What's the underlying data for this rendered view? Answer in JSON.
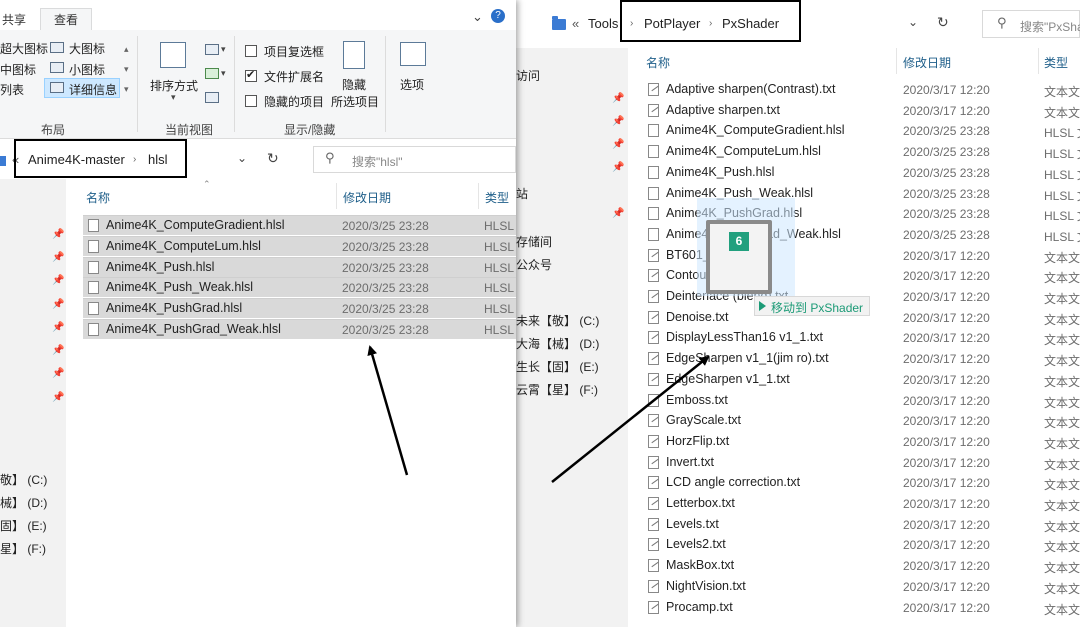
{
  "right_window": {
    "breadcrumb": {
      "overflow": "«",
      "items": [
        "Tools",
        "PotPlayer",
        "PxShader"
      ]
    },
    "search_placeholder": "搜索\"PxShad",
    "nav_items": [
      "访问",
      "站",
      "存储间",
      "公众号",
      "未来【敬】 (C:)",
      "大海【械】 (D:)",
      "生长【固】 (E:)",
      "云霄【星】 (F:)"
    ],
    "columns": {
      "name": "名称",
      "date": "修改日期",
      "type": "类型"
    },
    "files": [
      {
        "name": "Adaptive sharpen(Contrast).txt",
        "date": "2020/3/17 12:20",
        "type": "文本文",
        "kind": "txt"
      },
      {
        "name": "Adaptive sharpen.txt",
        "date": "2020/3/17 12:20",
        "type": "文本文",
        "kind": "txt"
      },
      {
        "name": "Anime4K_ComputeGradient.hlsl",
        "date": "2020/3/25 23:28",
        "type": "HLSL 文",
        "kind": "hlsl"
      },
      {
        "name": "Anime4K_ComputeLum.hlsl",
        "date": "2020/3/25 23:28",
        "type": "HLSL 文",
        "kind": "hlsl"
      },
      {
        "name": "Anime4K_Push.hlsl",
        "date": "2020/3/25 23:28",
        "type": "HLSL 文",
        "kind": "hlsl"
      },
      {
        "name": "Anime4K_Push_Weak.hlsl",
        "date": "2020/3/25 23:28",
        "type": "HLSL 文",
        "kind": "hlsl"
      },
      {
        "name": "Anime4K_PushGrad.hlsl",
        "date": "2020/3/25 23:28",
        "type": "HLSL 文",
        "kind": "hlsl"
      },
      {
        "name": "Anime4K_PushGrad_Weak.hlsl",
        "date": "2020/3/25 23:28",
        "type": "HLSL 文",
        "kind": "hlsl"
      },
      {
        "name": "BT601_BT709.txt",
        "date": "2020/3/17 12:20",
        "type": "文本文",
        "kind": "txt"
      },
      {
        "name": "Contour.txt",
        "date": "2020/3/17 12:20",
        "type": "文本文",
        "kind": "txt"
      },
      {
        "name": "Deinterlace (blend).txt",
        "date": "2020/3/17 12:20",
        "type": "文本文",
        "kind": "txt"
      },
      {
        "name": "Denoise.txt",
        "date": "2020/3/17 12:20",
        "type": "文本文",
        "kind": "txt"
      },
      {
        "name": "DisplayLessThan16 v1_1.txt",
        "date": "2020/3/17 12:20",
        "type": "文本文",
        "kind": "txt"
      },
      {
        "name": "EdgeSharpen v1_1(jim ro).txt",
        "date": "2020/3/17 12:20",
        "type": "文本文",
        "kind": "txt"
      },
      {
        "name": "EdgeSharpen v1_1.txt",
        "date": "2020/3/17 12:20",
        "type": "文本文",
        "kind": "txt"
      },
      {
        "name": "Emboss.txt",
        "date": "2020/3/17 12:20",
        "type": "文本文",
        "kind": "txt"
      },
      {
        "name": "GrayScale.txt",
        "date": "2020/3/17 12:20",
        "type": "文本文",
        "kind": "txt"
      },
      {
        "name": "HorzFlip.txt",
        "date": "2020/3/17 12:20",
        "type": "文本文",
        "kind": "txt"
      },
      {
        "name": "Invert.txt",
        "date": "2020/3/17 12:20",
        "type": "文本文",
        "kind": "txt"
      },
      {
        "name": "LCD angle correction.txt",
        "date": "2020/3/17 12:20",
        "type": "文本文",
        "kind": "txt"
      },
      {
        "name": "Letterbox.txt",
        "date": "2020/3/17 12:20",
        "type": "文本文",
        "kind": "txt"
      },
      {
        "name": "Levels.txt",
        "date": "2020/3/17 12:20",
        "type": "文本文",
        "kind": "txt"
      },
      {
        "name": "Levels2.txt",
        "date": "2020/3/17 12:20",
        "type": "文本文",
        "kind": "txt"
      },
      {
        "name": "MaskBox.txt",
        "date": "2020/3/17 12:20",
        "type": "文本文",
        "kind": "txt"
      },
      {
        "name": "NightVision.txt",
        "date": "2020/3/17 12:20",
        "type": "文本文",
        "kind": "txt"
      },
      {
        "name": "Procamp.txt",
        "date": "2020/3/17 12:20",
        "type": "文本文",
        "kind": "txt"
      }
    ]
  },
  "left_window": {
    "ribbon_tabs": [
      "共享",
      "查看"
    ],
    "ribbon": {
      "layout": {
        "options": [
          "超大图标",
          "大图标",
          "中图标",
          "小图标",
          "列表",
          "详细信息"
        ],
        "selected": "详细信息",
        "group_label": "布局"
      },
      "current_view": {
        "sort_label": "排序方式",
        "group_label": "当前视图"
      },
      "show_hide": {
        "checkboxes": [
          {
            "label": "项目复选框",
            "checked": false
          },
          {
            "label": "文件扩展名",
            "checked": true
          },
          {
            "label": "隐藏的项目",
            "checked": false
          }
        ],
        "hide_selected": [
          "隐藏",
          "所选项目"
        ],
        "group_label": "显示/隐藏"
      },
      "options_label": "选项"
    },
    "breadcrumb": {
      "overflow": "«",
      "items": [
        "Anime4K-master",
        "hlsl"
      ]
    },
    "search_placeholder": "搜索\"hlsl\"",
    "nav_items": [
      "敬】 (C:)",
      "械】 (D:)",
      "固】 (E:)",
      "星】 (F:)"
    ],
    "columns": {
      "name": "名称",
      "date": "修改日期",
      "type": "类型"
    },
    "files": [
      {
        "name": "Anime4K_ComputeGradient.hlsl",
        "date": "2020/3/25 23:28",
        "type": "HLSL"
      },
      {
        "name": "Anime4K_ComputeLum.hlsl",
        "date": "2020/3/25 23:28",
        "type": "HLSL"
      },
      {
        "name": "Anime4K_Push.hlsl",
        "date": "2020/3/25 23:28",
        "type": "HLSL"
      },
      {
        "name": "Anime4K_Push_Weak.hlsl",
        "date": "2020/3/25 23:28",
        "type": "HLSL"
      },
      {
        "name": "Anime4K_PushGrad.hlsl",
        "date": "2020/3/25 23:28",
        "type": "HLSL"
      },
      {
        "name": "Anime4K_PushGrad_Weak.hlsl",
        "date": "2020/3/25 23:28",
        "type": "HLSL"
      }
    ]
  },
  "drag": {
    "count": "6",
    "tooltip": "移动到 PxShader"
  },
  "icons": {
    "folder": "folder-icon",
    "refresh": "refresh-icon",
    "dropdown": "chevron-down-icon",
    "search": "search-icon",
    "pin": "pin-icon",
    "file": "file-icon",
    "close": "close-icon",
    "help": "help-icon"
  },
  "colors": {
    "accent": "#1f5f8a",
    "selection": "#cde8ff",
    "drag_badge": "#21a07e",
    "folder": "#3b7bd4"
  }
}
